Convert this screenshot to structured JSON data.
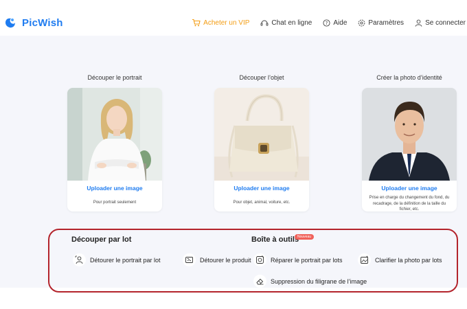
{
  "header": {
    "logo_text": "PicWish",
    "nav": {
      "vip": "Acheter un VIP",
      "chat": "Chat en ligne",
      "help": "Aide",
      "settings": "Paramètres",
      "login": "Se connecter"
    },
    "vip_color": "#f39c12",
    "brand_color": "#1f7cf0"
  },
  "cards": [
    {
      "title": "Découper le portrait",
      "link": "Uploader une image",
      "desc": "Pour portrait seulement"
    },
    {
      "title": "Découper l’objet",
      "link": "Uploader une image",
      "desc": "Pour objet, animal, voiture, etc."
    },
    {
      "title": "Créer la photo d’identité",
      "link": "Uploader une image",
      "desc": "Prise en charge du changement du fond, du recadrage, de la définition de la taille du fichier, etc."
    }
  ],
  "batch": {
    "title": "Découper par lot",
    "items": [
      "Détourer le portrait par lot",
      "Détourer le produit"
    ]
  },
  "toolbox": {
    "title": "Boîte à outils",
    "badge": "Nouveau",
    "items": [
      "Réparer le portrait par lots",
      "Clarifier la photo par lots",
      "Suppression du filigrane de l’image"
    ]
  },
  "accent_colors": {
    "highlight_border": "#b3232b",
    "badge": "#f0615a"
  }
}
